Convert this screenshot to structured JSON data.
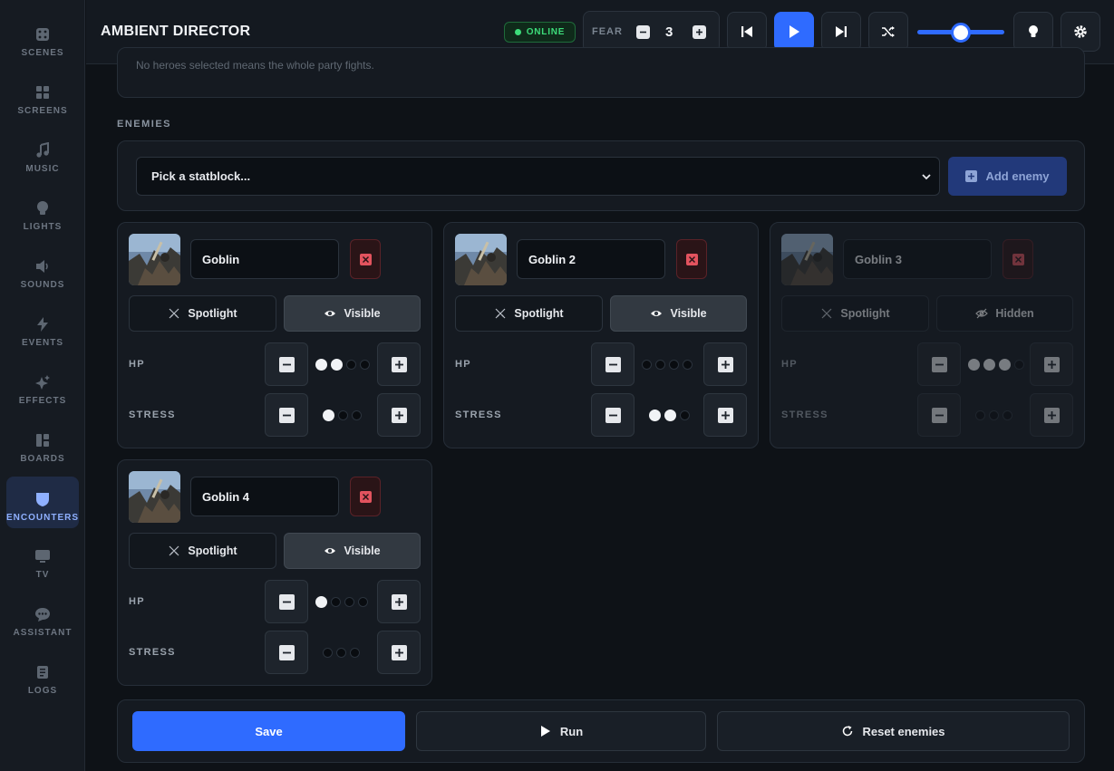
{
  "nav": [
    {
      "label": "SCENES",
      "icon": "dice-icon"
    },
    {
      "label": "SCREENS",
      "icon": "grid-icon"
    },
    {
      "label": "MUSIC",
      "icon": "music-note-icon"
    },
    {
      "label": "LIGHTS",
      "icon": "lightbulb-icon"
    },
    {
      "label": "SOUNDS",
      "icon": "speaker-icon"
    },
    {
      "label": "EVENTS",
      "icon": "bolt-icon"
    },
    {
      "label": "EFFECTS",
      "icon": "sparkle-icon"
    },
    {
      "label": "BOARDS",
      "icon": "board-icon"
    },
    {
      "label": "ENCOUNTERS",
      "icon": "shield-icon",
      "active": true
    },
    {
      "label": "TV",
      "icon": "tv-icon"
    },
    {
      "label": "ASSISTANT",
      "icon": "chat-icon"
    },
    {
      "label": "LOGS",
      "icon": "scroll-icon"
    }
  ],
  "header": {
    "title": "AMBIENT DIRECTOR",
    "status": "ONLINE",
    "fear_label": "FEAR",
    "fear_value": "3",
    "volume_level": 0.45,
    "colors": {
      "accent": "#2f6bff",
      "online": "#3ddc7a",
      "danger": "#e2535e"
    }
  },
  "party_note": "No heroes selected means the whole party fights.",
  "enemies_section": {
    "label": "ENEMIES",
    "picker_placeholder": "Pick a statblock...",
    "add_label": "Add enemy"
  },
  "enemies": [
    {
      "name": "Goblin",
      "spotlight_label": "Spotlight",
      "visibility_label": "Visible",
      "visible": true,
      "hp_label": "HP",
      "hp": {
        "filled": 2,
        "max": 4
      },
      "stress_label": "STRESS",
      "stress": {
        "filled": 1,
        "max": 3
      }
    },
    {
      "name": "Goblin 2",
      "spotlight_label": "Spotlight",
      "visibility_label": "Visible",
      "visible": true,
      "hp_label": "HP",
      "hp": {
        "filled": 0,
        "max": 4
      },
      "stress_label": "STRESS",
      "stress": {
        "filled": 2,
        "max": 3
      }
    },
    {
      "name": "Goblin 3",
      "spotlight_label": "Spotlight",
      "visibility_label": "Hidden",
      "visible": false,
      "hp_label": "HP",
      "hp": {
        "filled": 3,
        "max": 4
      },
      "stress_label": "STRESS",
      "stress": {
        "filled": 0,
        "max": 3
      }
    },
    {
      "name": "Goblin 4",
      "spotlight_label": "Spotlight",
      "visibility_label": "Visible",
      "visible": true,
      "hp_label": "HP",
      "hp": {
        "filled": 1,
        "max": 4
      },
      "stress_label": "STRESS",
      "stress": {
        "filled": 0,
        "max": 3
      }
    }
  ],
  "footer": {
    "save_label": "Save",
    "run_label": "Run",
    "reset_label": "Reset enemies"
  }
}
